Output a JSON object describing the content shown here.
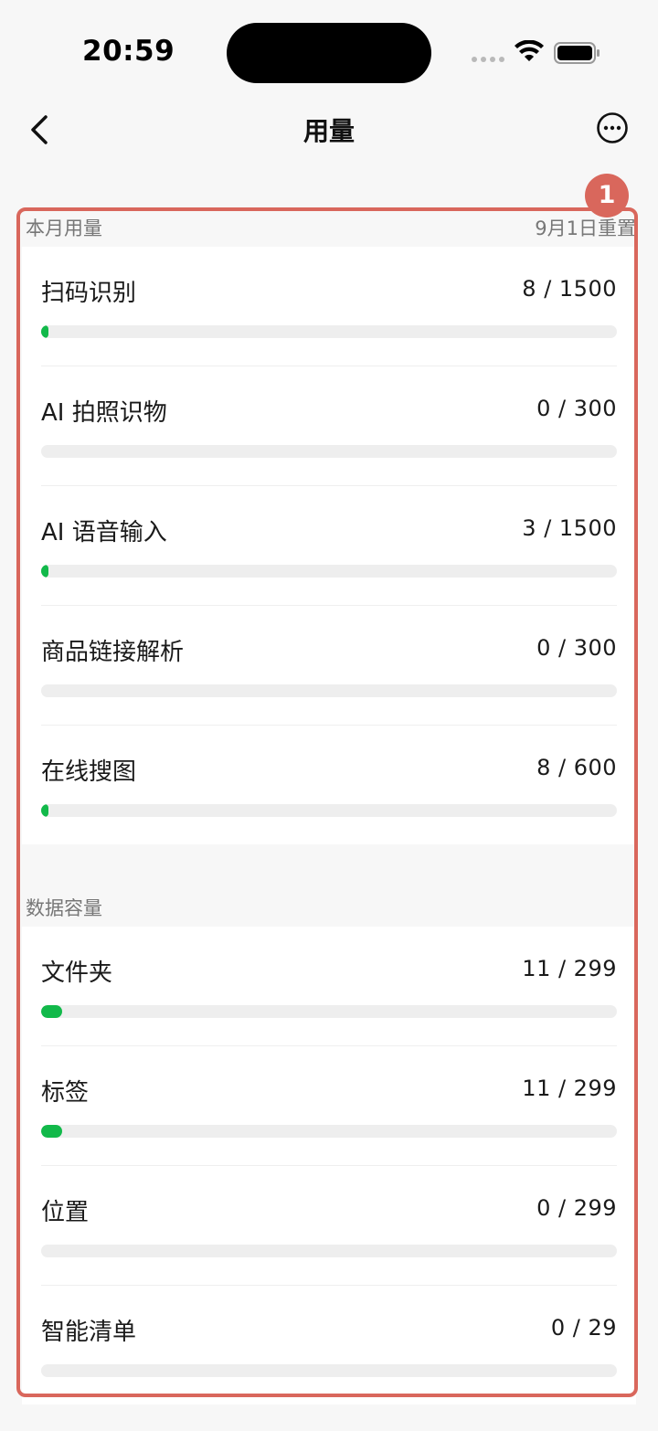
{
  "status_bar": {
    "time": "20:59"
  },
  "nav": {
    "title": "用量"
  },
  "monthly": {
    "header": "本月用量",
    "reset_note": "9月1日重置",
    "items": [
      {
        "label": "扫码识别",
        "value": "8 / 1500",
        "used": 8,
        "limit": 1500
      },
      {
        "label": "AI 拍照识物",
        "value": "0 / 300",
        "used": 0,
        "limit": 300
      },
      {
        "label": "AI 语音输入",
        "value": "3 / 1500",
        "used": 3,
        "limit": 1500
      },
      {
        "label": "商品链接解析",
        "value": "0 / 300",
        "used": 0,
        "limit": 300
      },
      {
        "label": "在线搜图",
        "value": "8 / 600",
        "used": 8,
        "limit": 600
      }
    ]
  },
  "storage": {
    "header": "数据容量",
    "items": [
      {
        "label": "文件夹",
        "value": "11 / 299",
        "used": 11,
        "limit": 299
      },
      {
        "label": "标签",
        "value": "11 / 299",
        "used": 11,
        "limit": 299
      },
      {
        "label": "位置",
        "value": "0 / 299",
        "used": 0,
        "limit": 299
      },
      {
        "label": "智能清单",
        "value": "0 / 29",
        "used": 0,
        "limit": 29
      }
    ]
  },
  "annotation": {
    "badge": "1"
  },
  "colors": {
    "progress_fill": "#12b94a",
    "progress_track": "#eeeeee",
    "annotation": "#d9675c"
  },
  "icons": {
    "back": "chevron-left-icon",
    "more": "more-circle-icon",
    "wifi": "wifi-icon",
    "battery": "battery-icon"
  }
}
